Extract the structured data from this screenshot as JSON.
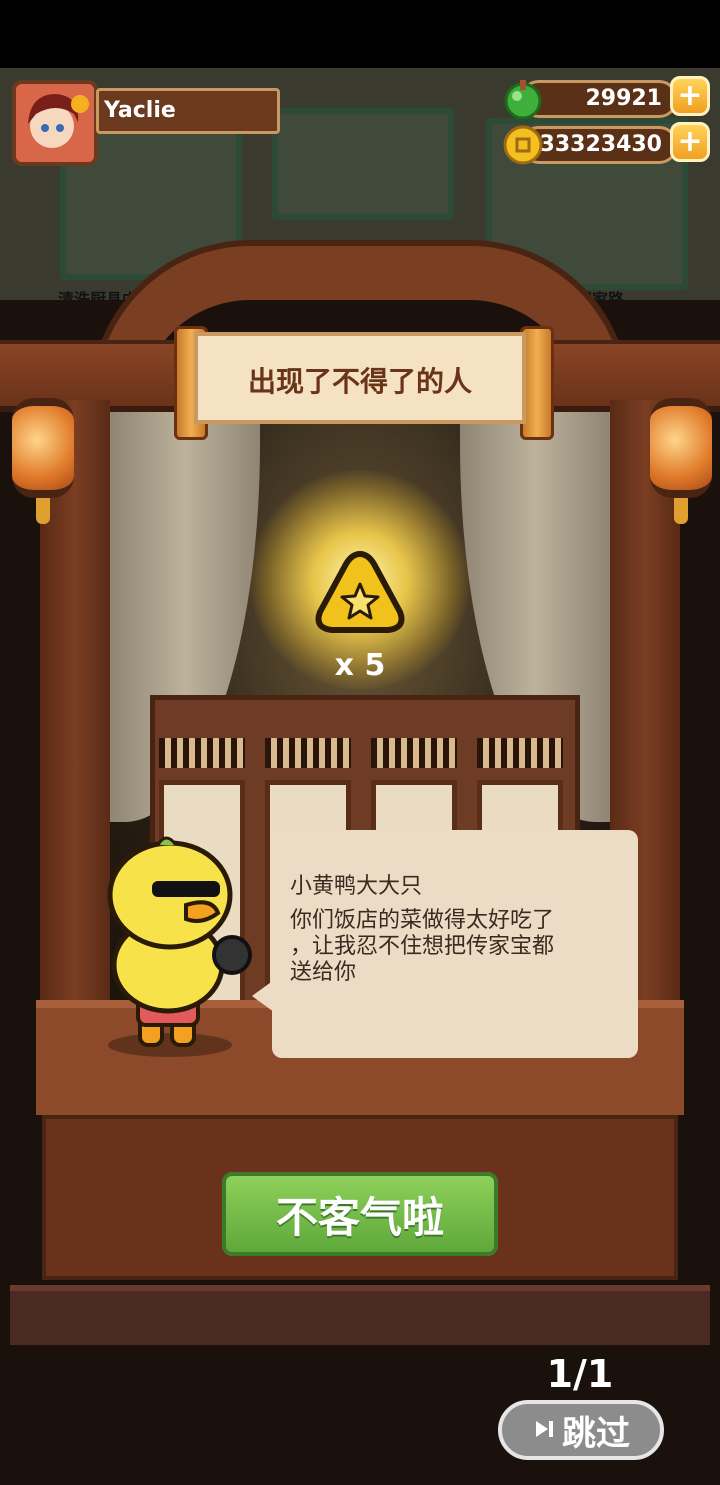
{
  "player": {
    "name": "Yaclie"
  },
  "currencies": [
    {
      "icon": "jade-gem-icon",
      "value": "29921"
    },
    {
      "icon": "gold-coin-icon",
      "value": "33323430"
    }
  ],
  "background_hint": {
    "left": "清洗厨具中",
    "right": "正回家路"
  },
  "event": {
    "title": "出现了不得了的人",
    "reward": {
      "icon": "star-rice-ball-icon",
      "quantity": "x 5"
    },
    "speaker": "小黄鸭大大只",
    "dialog": "你们饭店的菜做得太好吃了\n，让我忍不住想把传家宝都\n送给你",
    "confirm_label": "不客气啦"
  },
  "pager": {
    "current": "1/1"
  },
  "skip": {
    "label": "跳过",
    "icon": "skip-icon"
  },
  "colors": {
    "accent_green": "#6ab842",
    "wood": "#7a3e22",
    "gold": "#f0c030"
  }
}
